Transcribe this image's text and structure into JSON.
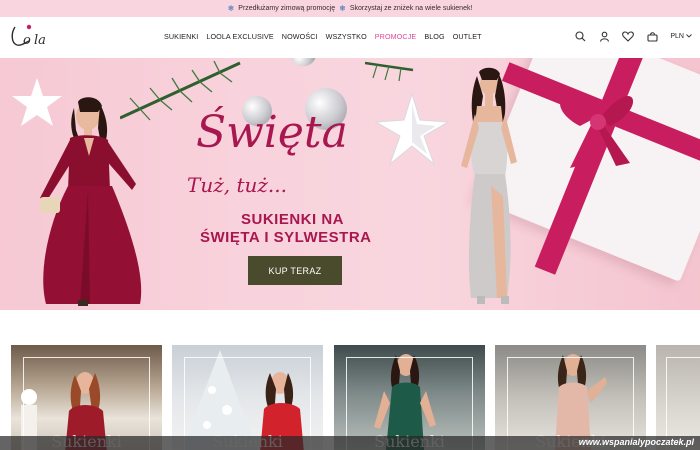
{
  "promo_bar": {
    "text_1": "Przedłużamy zimową promocję",
    "text_2": "Skorzystaj ze zniżek na wiele sukienek!",
    "icon": "snowflake-icon"
  },
  "header": {
    "logo_text": "Loola",
    "nav": [
      {
        "label": "SUKIENKI",
        "active": false
      },
      {
        "label": "LOOLA EXCLUSIVE",
        "active": false
      },
      {
        "label": "NOWOŚCI",
        "active": false
      },
      {
        "label": "WSZYSTKO",
        "active": false
      },
      {
        "label": "PROMOCJE",
        "active": true
      },
      {
        "label": "BLOG",
        "active": false
      },
      {
        "label": "OUTLET",
        "active": false
      }
    ],
    "icons": [
      "search-icon",
      "user-icon",
      "heart-icon",
      "bag-icon"
    ],
    "currency": "PLN"
  },
  "hero": {
    "headline": "Święta",
    "tagline": "Tuż, tuż...",
    "subtitle_line1": "SUKIENKI NA",
    "subtitle_line2": "ŚWIĘTA I SYLWESTRA",
    "cta_label": "KUP TERAZ",
    "accent_color": "#a8174f",
    "cta_color": "#4a4a2c"
  },
  "categories": [
    {
      "label": "Sukienki"
    },
    {
      "label": "Sukienki"
    },
    {
      "label": "Sukienki"
    },
    {
      "label": "Sukienki"
    }
  ],
  "watermark": "www.wspanialypoczatek.pl",
  "colors": {
    "promo_bg": "#f9d5e0",
    "active_nav": "#e0479a"
  }
}
